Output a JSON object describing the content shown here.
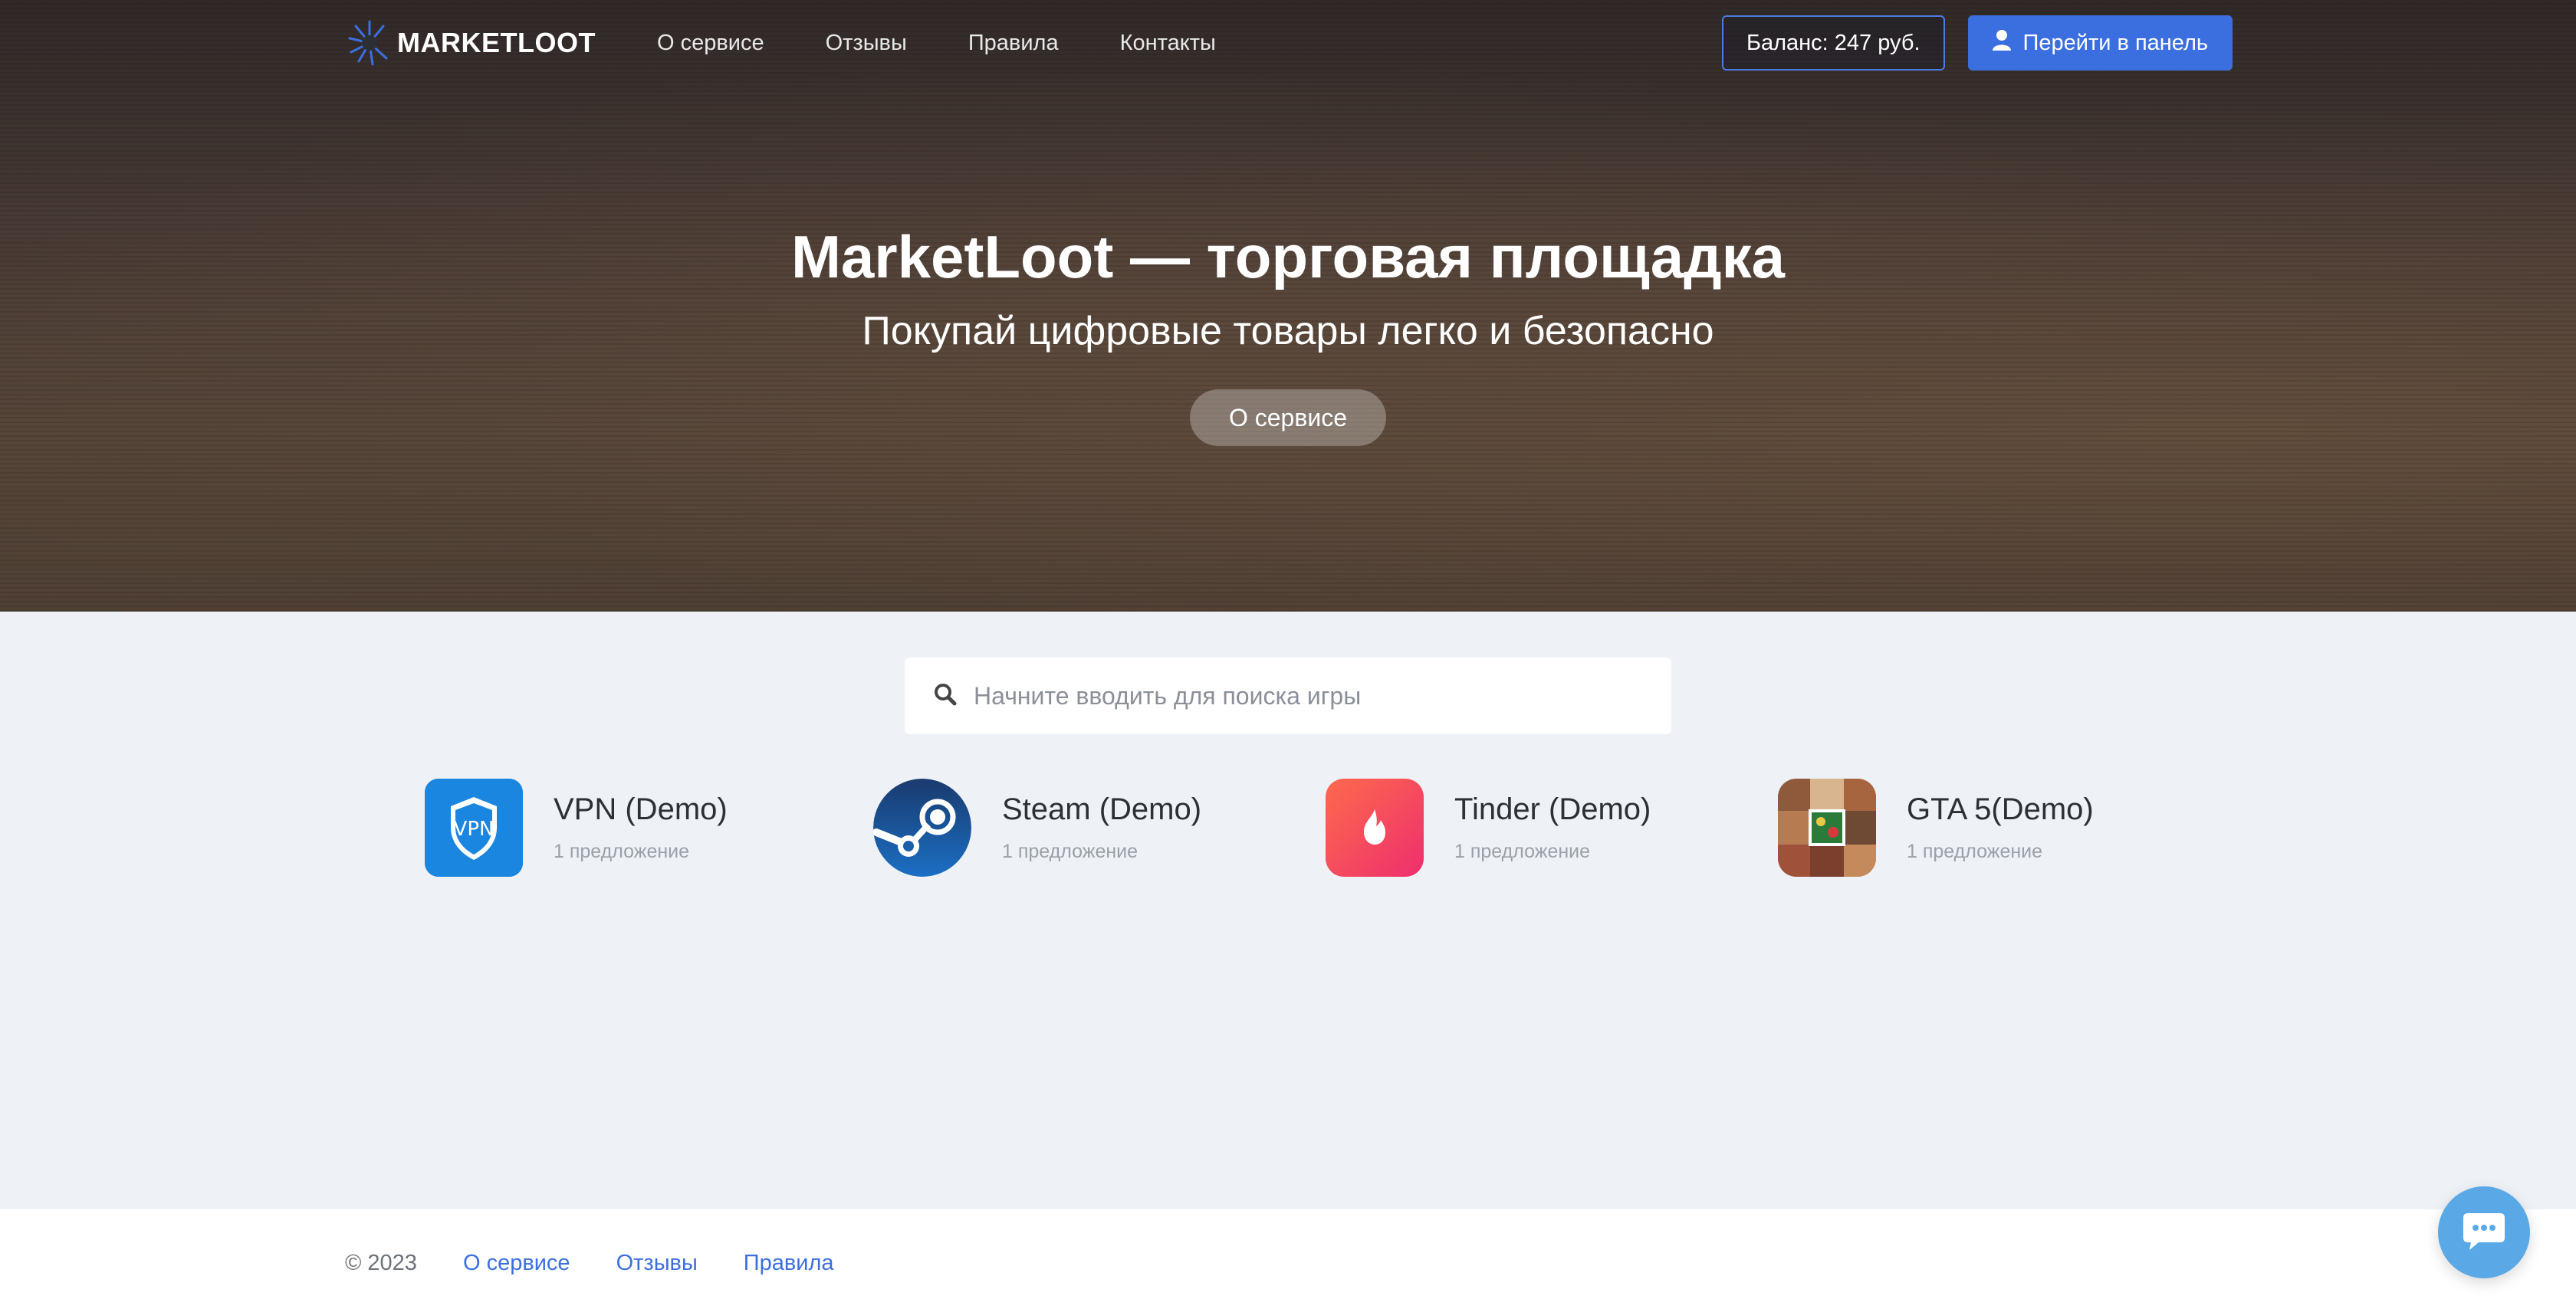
{
  "header": {
    "logo_text": "MARKETLOOT",
    "nav": [
      {
        "label": "О сервисе"
      },
      {
        "label": "Отзывы"
      },
      {
        "label": "Правила"
      },
      {
        "label": "Контакты"
      }
    ],
    "balance_label": "Баланс: 247 руб.",
    "panel_label": "Перейти в панель",
    "accent_color": "#3b6fe0"
  },
  "hero": {
    "title": "MarketLoot — торговая площадка",
    "subtitle": "Покупай цифровые товары легко и безопасно",
    "button_label": "О сервисе"
  },
  "search": {
    "placeholder": "Начните вводить для поиска игры",
    "value": ""
  },
  "products": [
    {
      "name": "VPN (Demo)",
      "count": "1 предложение",
      "icon": "vpn-shield-icon"
    },
    {
      "name": "Steam (Demo)",
      "count": "1 предложение",
      "icon": "steam-icon"
    },
    {
      "name": "Tinder (Demo)",
      "count": "1 предложение",
      "icon": "tinder-flame-icon"
    },
    {
      "name": "GTA 5(Demo)",
      "count": "1 предложение",
      "icon": "gta5-cover-icon"
    }
  ],
  "footer": {
    "copyright": "© 2023",
    "links": [
      {
        "label": "О сервисе"
      },
      {
        "label": "Отзывы"
      },
      {
        "label": "Правила"
      }
    ]
  },
  "chat": {
    "icon": "chat-bubble-icon"
  }
}
